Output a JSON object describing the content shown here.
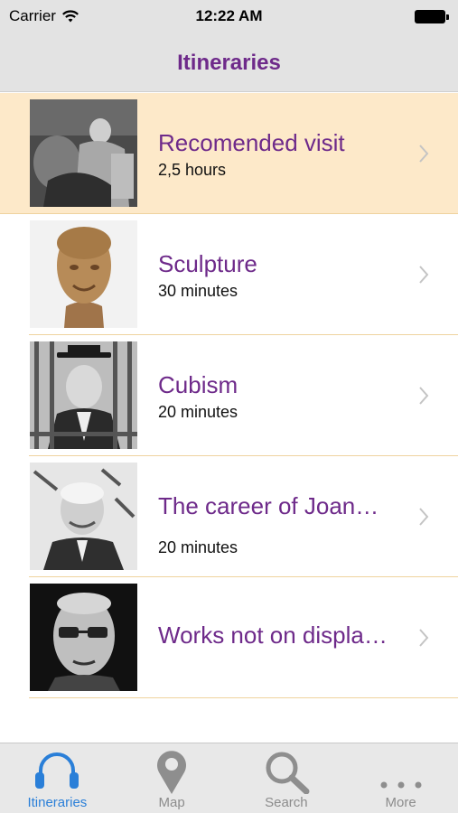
{
  "status_bar": {
    "carrier": "Carrier",
    "time": "12:22 AM"
  },
  "nav": {
    "title": "Itineraries"
  },
  "itineraries": [
    {
      "title": "Recomended visit",
      "duration": "2,5 hours",
      "selected": true
    },
    {
      "title": "Sculpture",
      "duration": "30 minutes"
    },
    {
      "title": "Cubism",
      "duration": "20 minutes"
    },
    {
      "title": "The career of Joan…",
      "duration": "20 minutes"
    },
    {
      "title": "Works not on displa…",
      "duration": ""
    }
  ],
  "tabs": [
    {
      "label": "Itineraries",
      "icon": "headphones-icon",
      "active": true
    },
    {
      "label": "Map",
      "icon": "map-pin-icon"
    },
    {
      "label": "Search",
      "icon": "search-icon"
    },
    {
      "label": "More",
      "icon": "more-icon"
    }
  ],
  "colors": {
    "accent": "#6e2a8a",
    "tab_active": "#2a7fd8",
    "selected_row": "#fde9c9"
  }
}
